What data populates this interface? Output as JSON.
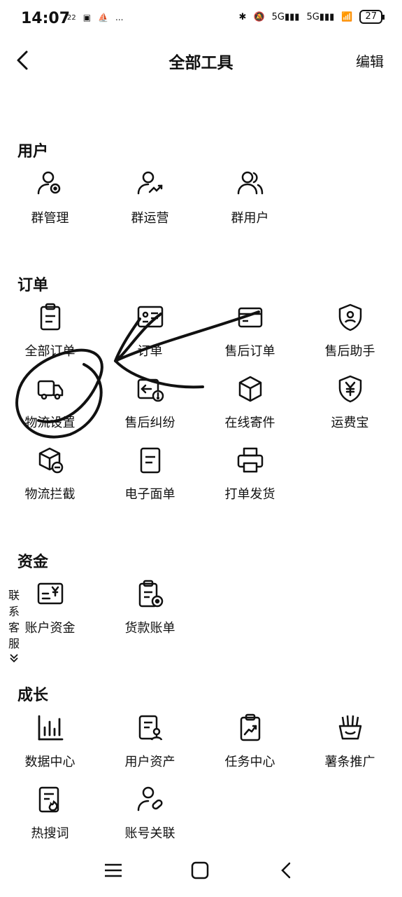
{
  "status_bar": {
    "time": "14:07",
    "left_icons": [
      "22",
      "notification-icon",
      "boat-icon",
      "..."
    ],
    "battery": "27"
  },
  "header": {
    "title": "全部工具",
    "edit_label": "编辑"
  },
  "sections": {
    "user": {
      "title": "用户",
      "tools": [
        {
          "label": "群管理",
          "icon": "group-manage-icon"
        },
        {
          "label": "群运营",
          "icon": "group-operation-icon"
        },
        {
          "label": "群用户",
          "icon": "group-users-icon"
        }
      ]
    },
    "order": {
      "title": "订单",
      "tools": [
        {
          "label": "全部订单",
          "icon": "clipboard-icon"
        },
        {
          "label": "订单",
          "icon": "id-card-icon"
        },
        {
          "label": "售后订单",
          "icon": "card-icon"
        },
        {
          "label": "售后助手",
          "icon": "shield-user-icon"
        },
        {
          "label": "物流设置",
          "icon": "truck-icon"
        },
        {
          "label": "售后纠纷",
          "icon": "return-alert-icon"
        },
        {
          "label": "在线寄件",
          "icon": "package-icon"
        },
        {
          "label": "运费宝",
          "icon": "yen-shield-icon"
        },
        {
          "label": "物流拦截",
          "icon": "box-block-icon"
        },
        {
          "label": "电子面单",
          "icon": "document-icon"
        },
        {
          "label": "打单发货",
          "icon": "printer-icon"
        }
      ]
    },
    "funds": {
      "title": "资金",
      "tools": [
        {
          "label": "账户资金",
          "icon": "wallet-yen-icon"
        },
        {
          "label": "货款账单",
          "icon": "bill-icon"
        }
      ]
    },
    "growth": {
      "title": "成长",
      "tools": [
        {
          "label": "数据中心",
          "icon": "bar-chart-icon"
        },
        {
          "label": "用户资产",
          "icon": "user-doc-icon"
        },
        {
          "label": "任务中心",
          "icon": "task-trend-icon"
        },
        {
          "label": "薯条推广",
          "icon": "fries-icon"
        },
        {
          "label": "热搜词",
          "icon": "hot-doc-icon"
        },
        {
          "label": "账号关联",
          "icon": "user-link-icon"
        }
      ]
    }
  },
  "contact_service": {
    "chars": [
      "联",
      "系",
      "客",
      "服"
    ]
  },
  "colors": {
    "text": "#111111",
    "background": "#ffffff",
    "annotation": "#111111"
  }
}
